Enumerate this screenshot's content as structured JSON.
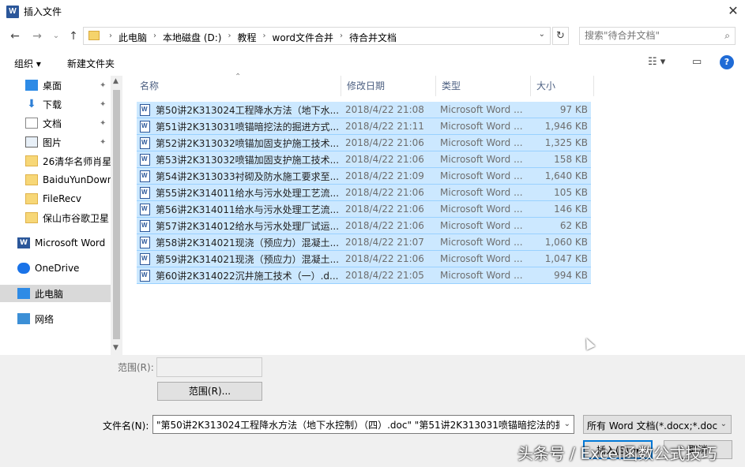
{
  "window": {
    "title": "插入文件",
    "app_icon": "W",
    "close_glyph": "✕"
  },
  "nav": {
    "back": "←",
    "forward": "→",
    "recent": "⌄",
    "up": "↑",
    "breadcrumbs": [
      "此电脑",
      "本地磁盘 (D:)",
      "教程",
      "word文件合并",
      "待合并文档"
    ],
    "refresh": "↻",
    "search_placeholder": "搜索\"待合并文档\""
  },
  "toolbar": {
    "organize": "组织 ▾",
    "new_folder": "新建文件夹",
    "view": "☷ ▾",
    "preview": "▭",
    "help": "?"
  },
  "sidebar": {
    "items": [
      {
        "label": "桌面",
        "icon": "desktop-icon",
        "pinned": true
      },
      {
        "label": "下载",
        "icon": "download-icon",
        "pinned": true
      },
      {
        "label": "文档",
        "icon": "document-icon",
        "pinned": true
      },
      {
        "label": "图片",
        "icon": "picture-icon",
        "pinned": true
      },
      {
        "label": "26清华名师肖星",
        "icon": "folder-icon",
        "pinned": false
      },
      {
        "label": "BaiduYunDownl",
        "icon": "folder-icon",
        "pinned": false
      },
      {
        "label": "FileRecv",
        "icon": "folder-icon",
        "pinned": false
      },
      {
        "label": "保山市谷歌卫星",
        "icon": "folder-icon",
        "pinned": false
      },
      {
        "label": "Microsoft Word",
        "icon": "word-icon",
        "pinned": false
      },
      {
        "label": "OneDrive",
        "icon": "cloud-icon",
        "pinned": false
      },
      {
        "label": "此电脑",
        "icon": "pc-icon",
        "pinned": false,
        "selected": true
      },
      {
        "label": "网络",
        "icon": "network-icon",
        "pinned": false
      }
    ],
    "pin_glyph": "📌"
  },
  "columns": {
    "name": "名称",
    "modified": "修改日期",
    "type": "类型",
    "size": "大小"
  },
  "files": [
    {
      "name": "第50讲2K313024工程降水方法（地下水...",
      "date": "2018/4/22 21:08",
      "type": "Microsoft Word ...",
      "size": "97 KB"
    },
    {
      "name": "第51讲2K313031喷锚暗挖法的掘进方式...",
      "date": "2018/4/22 21:11",
      "type": "Microsoft Word ...",
      "size": "1,946 KB"
    },
    {
      "name": "第52讲2K313032喷锚加固支护施工技术...",
      "date": "2018/4/22 21:06",
      "type": "Microsoft Word ...",
      "size": "1,325 KB"
    },
    {
      "name": "第53讲2K313032喷锚加固支护施工技术...",
      "date": "2018/4/22 21:06",
      "type": "Microsoft Word ...",
      "size": "158 KB"
    },
    {
      "name": "第54讲2K313033衬砌及防水施工要求至...",
      "date": "2018/4/22 21:09",
      "type": "Microsoft Word ...",
      "size": "1,640 KB"
    },
    {
      "name": "第55讲2K314011给水与污水处理工艺流...",
      "date": "2018/4/22 21:06",
      "type": "Microsoft Word ...",
      "size": "105 KB"
    },
    {
      "name": "第56讲2K314011给水与污水处理工艺流...",
      "date": "2018/4/22 21:06",
      "type": "Microsoft Word ...",
      "size": "146 KB"
    },
    {
      "name": "第57讲2K314012给水与污水处理厂试运...",
      "date": "2018/4/22 21:06",
      "type": "Microsoft Word ...",
      "size": "62 KB"
    },
    {
      "name": "第58讲2K314021现浇（预应力）混凝土...",
      "date": "2018/4/22 21:07",
      "type": "Microsoft Word ...",
      "size": "1,060 KB"
    },
    {
      "name": "第59讲2K314021现浇（预应力）混凝土...",
      "date": "2018/4/22 21:06",
      "type": "Microsoft Word ...",
      "size": "1,047 KB"
    },
    {
      "name": "第60讲2K314022沉井施工技术（一）.d...",
      "date": "2018/4/22 21:05",
      "type": "Microsoft Word ...",
      "size": "994 KB"
    }
  ],
  "bottom": {
    "range_label": "范围(R):",
    "range_button": "范围(R)...",
    "filename_label": "文件名(N):",
    "filename_value": "\"第50讲2K313024工程降水方法（地下水控制）（四）.doc\" \"第51讲2K313031喷锚暗挖法的掘",
    "filetype_value": "所有 Word 文档(*.docx;*.docm",
    "insert_button": "插入(S)",
    "cancel_button": "取消"
  },
  "watermark": "头条号 / Excel函数公式技巧"
}
